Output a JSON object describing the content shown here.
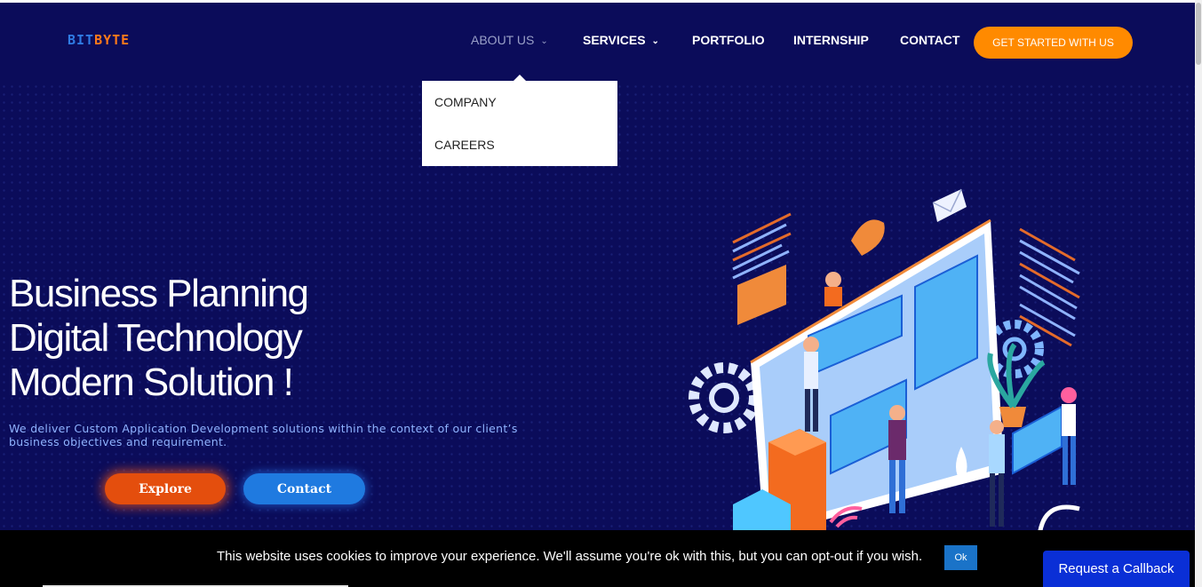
{
  "header": {
    "logo_part1": "BIT",
    "logo_part2": "BYTE",
    "nav": [
      {
        "label": "ABOUT US",
        "has_dropdown": true,
        "active": true
      },
      {
        "label": "SERVICES",
        "has_dropdown": true,
        "active": false
      },
      {
        "label": "PORTFOLIO",
        "has_dropdown": false,
        "active": false
      },
      {
        "label": "INTERNSHIP",
        "has_dropdown": false,
        "active": false
      },
      {
        "label": "CONTACT",
        "has_dropdown": false,
        "active": false
      }
    ],
    "cta_label": "GET STARTED WITH US"
  },
  "dropdown": {
    "items": [
      "COMPANY",
      "CAREERS"
    ]
  },
  "hero": {
    "title_lines": [
      "Business Planning",
      "Digital Technology",
      "Modern Solution !"
    ],
    "subtitle": "We deliver Custom Application Development solutions within the context of our client’s business objectives and requirement.",
    "explore_label": "Explore",
    "contact_label": "Contact"
  },
  "cookie": {
    "text": "This website uses cookies to improve your experience. We'll assume you're ok with this, but you can opt-out if you wish.",
    "ok_label": "Ok"
  },
  "callback_label": "Request a Callback",
  "icons": {
    "chevron": "chevron-down-icon",
    "illustration": "isometric-dashboard-illustration"
  },
  "colors": {
    "background": "#0b0c5a",
    "accent_orange": "#ff8a00",
    "accent_blue": "#1f7ae0",
    "callback_blue": "#0a2fd6"
  }
}
